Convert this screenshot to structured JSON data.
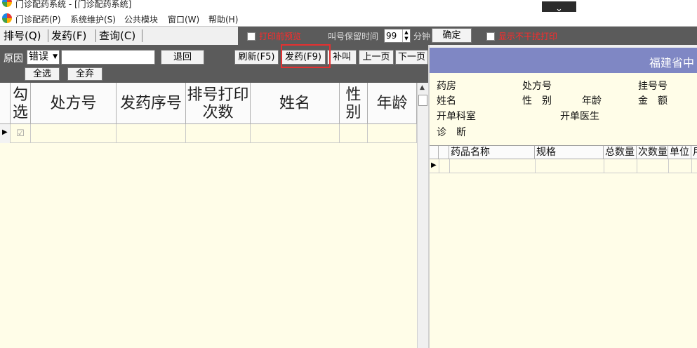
{
  "window": {
    "title": "门诊配药系统 - [门诊配药系统]",
    "collapse_glyph": "⌄"
  },
  "menu": [
    {
      "label": "门诊配药(P)"
    },
    {
      "label": "系统维护(S)"
    },
    {
      "label": "公共模块"
    },
    {
      "label": "窗口(W)"
    },
    {
      "label": "帮助(H)"
    }
  ],
  "tabs": [
    {
      "label": "排号(Q)"
    },
    {
      "label": "发药(F)"
    },
    {
      "label": "查询(C)"
    }
  ],
  "options": {
    "print_preview_label": "打印前预览",
    "keep_time_label": "叫号保留时间",
    "keep_time_value": "99",
    "minutes_label": "分钟",
    "confirm_label": "确定",
    "no_interrupt_print_label": "显示不干扰打印"
  },
  "left_toolbar": {
    "reason_label": "原因",
    "reason_value": "错误",
    "reason_input": "",
    "return_label": "退回",
    "refresh_label": "刷新(F5)",
    "dispense_label": "发药(F9)",
    "recall_label": "补叫",
    "prev_page_label": "上一页",
    "next_page_label": "下一页",
    "select_all_label": "全选",
    "discard_all_label": "全弃"
  },
  "grid": {
    "columns": [
      {
        "label": "勾选"
      },
      {
        "label": "处方号"
      },
      {
        "label": "发药序号"
      },
      {
        "label": "排号打印次数"
      },
      {
        "label": "姓名"
      },
      {
        "label": "性别"
      },
      {
        "label": "年龄"
      }
    ],
    "rows": [
      {
        "checked": "☑",
        "prescription_no": "",
        "dispense_seq": "",
        "print_count": "",
        "name": "",
        "gender": "",
        "age": ""
      }
    ]
  },
  "prescription": {
    "header": "福建省中",
    "labels": {
      "pharmacy": "药房",
      "prescription_no": "处方号",
      "registration_no": "挂号号",
      "name": "姓名",
      "gender": "性　别",
      "age": "年龄",
      "amount": "金　额",
      "department": "开单科室",
      "doctor": "开单医生",
      "diagnosis": "诊　断"
    },
    "drug_columns": [
      {
        "label": "药品名称"
      },
      {
        "label": "规格"
      },
      {
        "label": "总数量"
      },
      {
        "label": "次数量"
      },
      {
        "label": "单位"
      },
      {
        "label": "用"
      }
    ]
  },
  "colors": {
    "toolbar_bg": "#5b5b5b",
    "grid_bg": "#fffde8",
    "header_accent": "#7f87c4",
    "warning_text": "#ff2a2a",
    "highlight": "#e53030"
  }
}
